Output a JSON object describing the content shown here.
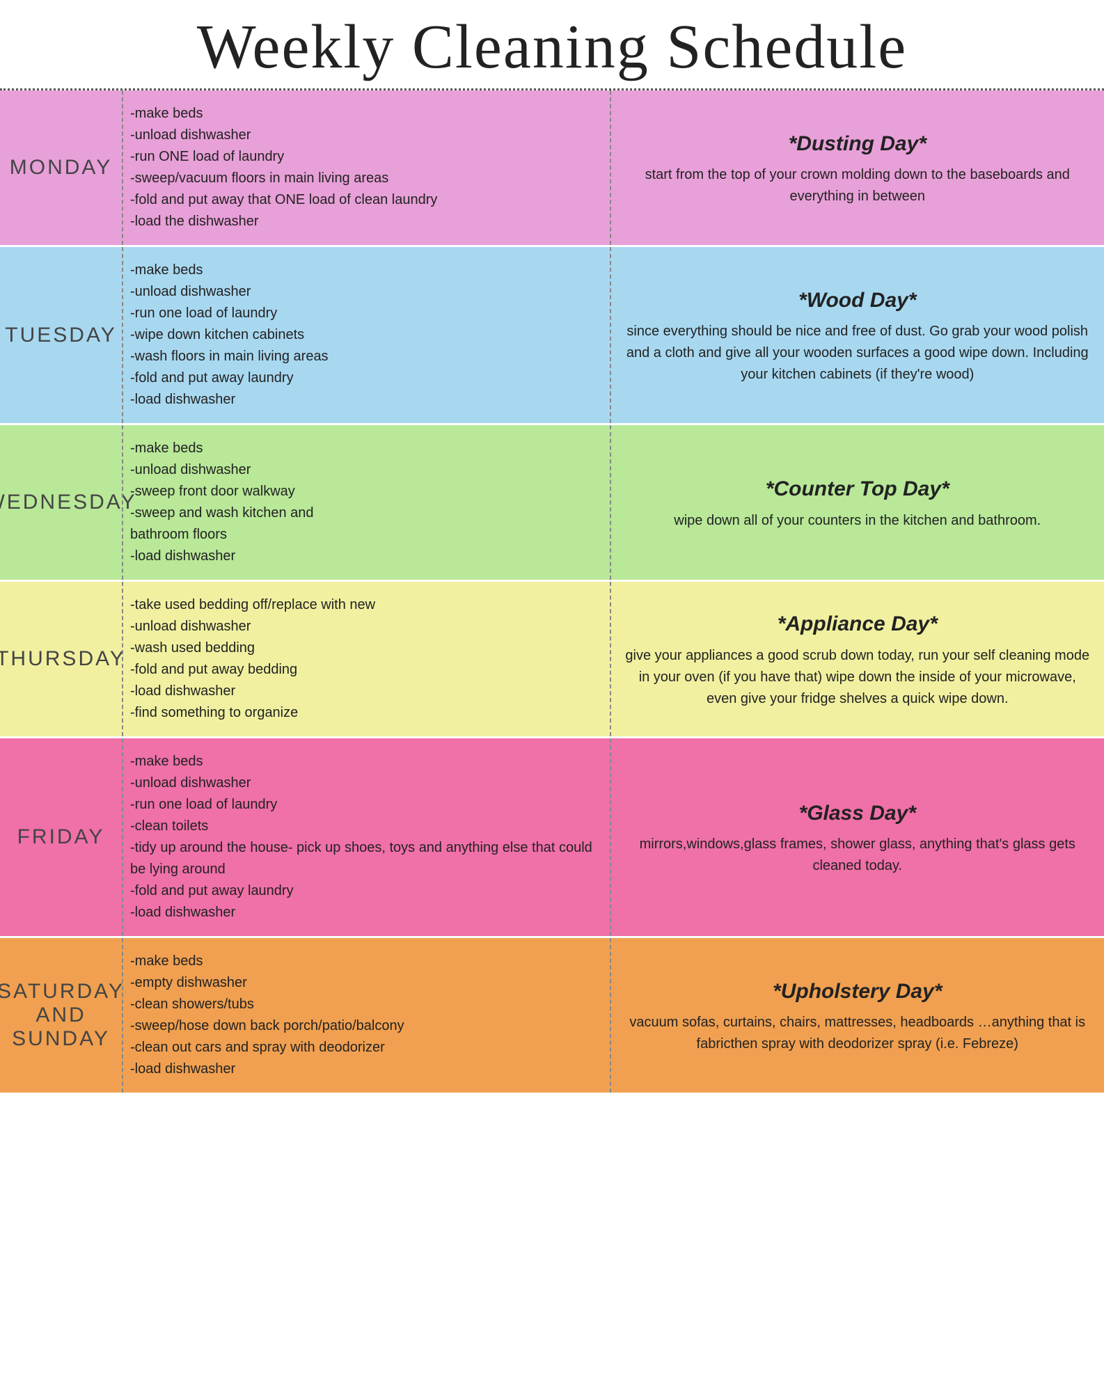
{
  "title": "Weekly Cleaning Schedule",
  "days": [
    {
      "id": "monday",
      "label": "MONDAY",
      "colorClass": "monday-row",
      "tasks": [
        "-make beds",
        "-unload dishwasher",
        "-run ONE load of laundry",
        "-sweep/vacuum floors in main living areas",
        "-fold and put away that ONE load of clean laundry",
        "-load the dishwasher"
      ],
      "specialTitle": "*Dusting Day*",
      "specialText": "start from the top of your crown molding down to the baseboards and everything in between"
    },
    {
      "id": "tuesday",
      "label": "TUESDAY",
      "colorClass": "tuesday-row",
      "tasks": [
        "-make beds",
        "-unload dishwasher",
        "-run one load of laundry",
        "-wipe down kitchen cabinets",
        "-wash floors in main living areas",
        "-fold and put away laundry",
        "-load dishwasher"
      ],
      "specialTitle": "*Wood Day*",
      "specialText": "since everything should be nice and free of dust. Go grab your wood polish and a cloth and give all your wooden surfaces a good wipe down. Including your kitchen cabinets (if they're wood)"
    },
    {
      "id": "wednesday",
      "label": "WEDNESDAY",
      "colorClass": "wednesday-row",
      "tasks": [
        "-make beds",
        "-unload dishwasher",
        "-sweep front door walkway",
        "-sweep and wash kitchen and\n  bathroom floors",
        "-load dishwasher"
      ],
      "specialTitle": "*Counter Top Day*",
      "specialText": "wipe down all of your counters in the kitchen and bathroom."
    },
    {
      "id": "thursday",
      "label": "THURSDAY",
      "colorClass": "thursday-row",
      "tasks": [
        "-take used bedding off/replace with new",
        "-unload dishwasher",
        "-wash used bedding",
        "-fold and put away bedding",
        "-load dishwasher",
        "-find something to organize"
      ],
      "specialTitle": "*Appliance Day*",
      "specialText": "give your appliances a good scrub down today, run your self cleaning mode in your oven (if you have that) wipe down the inside of your microwave, even give your fridge shelves a quick wipe down."
    },
    {
      "id": "friday",
      "label": "FRIDAY",
      "colorClass": "friday-row",
      "tasks": [
        "-make beds",
        "-unload dishwasher",
        "-run one load of laundry",
        "-clean toilets",
        "-tidy up around the house- pick up shoes, toys and anything else that could be lying around",
        "-fold and put away laundry",
        "-load dishwasher"
      ],
      "specialTitle": "*Glass Day*",
      "specialText": "mirrors,windows,glass frames, shower glass, anything that's glass gets cleaned today."
    },
    {
      "id": "saturday",
      "label": "SATURDAY\nAND\nSUNDAY",
      "colorClass": "saturday-row",
      "tasks": [
        "-make beds",
        "-empty dishwasher",
        "-clean showers/tubs",
        "-sweep/hose down back porch/patio/balcony",
        "-clean out cars and spray with deodorizer",
        "-load dishwasher"
      ],
      "specialTitle": "*Upholstery Day*",
      "specialText": "vacuum sofas, curtains, chairs, mattresses, headboards …anything that is fabricthen spray with deodorizer spray (i.e. Febreze)"
    }
  ]
}
